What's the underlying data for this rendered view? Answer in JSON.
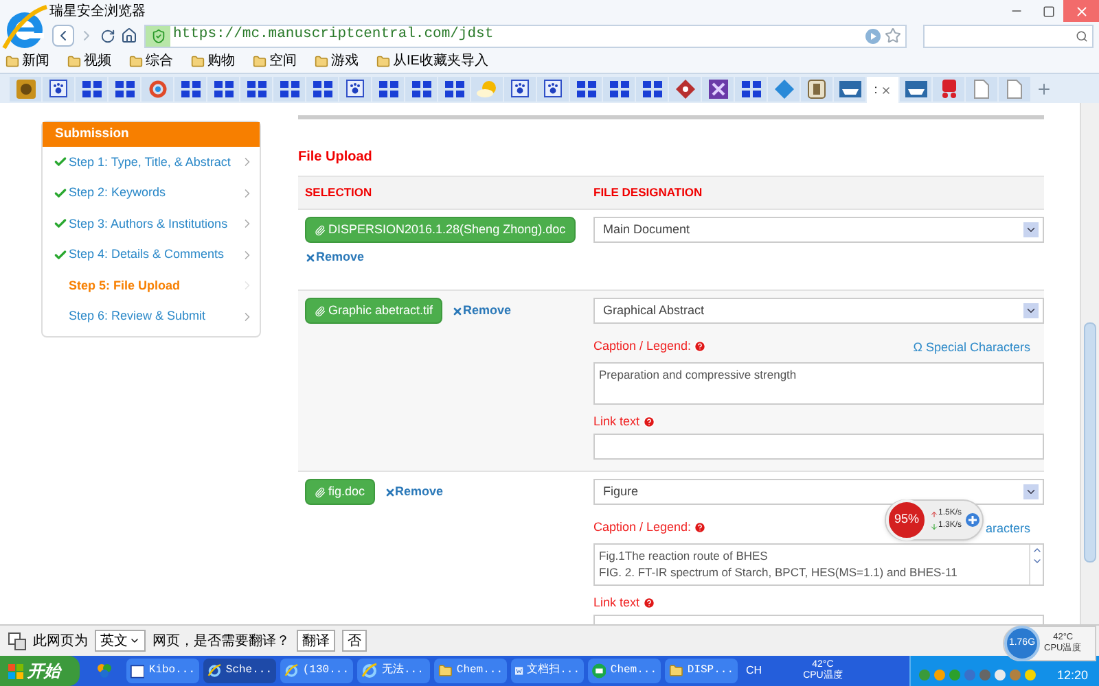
{
  "browser": {
    "title": "瑞星安全浏览器",
    "url": "https://mc.manuscriptcentral.com/jdst",
    "bookmarks": [
      "新闻",
      "视频",
      "综合",
      "购物",
      "空间",
      "游戏",
      "从IE收藏夹导入"
    ],
    "tabs": [
      {
        "kind": "tiger",
        "selected": false
      },
      {
        "kind": "paw",
        "selected": false
      },
      {
        "kind": "grid",
        "selected": false
      },
      {
        "kind": "grid",
        "selected": false
      },
      {
        "kind": "circle",
        "selected": false
      },
      {
        "kind": "grid",
        "selected": false
      },
      {
        "kind": "grid",
        "selected": false
      },
      {
        "kind": "grid",
        "selected": false
      },
      {
        "kind": "grid",
        "selected": false
      },
      {
        "kind": "grid",
        "selected": false
      },
      {
        "kind": "paw",
        "selected": false
      },
      {
        "kind": "grid",
        "selected": false
      },
      {
        "kind": "grid",
        "selected": false
      },
      {
        "kind": "grid",
        "selected": false
      },
      {
        "kind": "sun",
        "selected": false
      },
      {
        "kind": "paw",
        "selected": false
      },
      {
        "kind": "paw",
        "selected": false
      },
      {
        "kind": "grid",
        "selected": false
      },
      {
        "kind": "grid",
        "selected": false
      },
      {
        "kind": "grid",
        "selected": false
      },
      {
        "kind": "diamond",
        "selected": false
      },
      {
        "kind": "cross",
        "selected": false
      },
      {
        "kind": "grid",
        "selected": false
      },
      {
        "kind": "bluediamond",
        "selected": false
      },
      {
        "kind": "square",
        "selected": false
      },
      {
        "kind": "boat",
        "selected": false
      },
      {
        "kind": "blank",
        "selected": true,
        "label": ":"
      },
      {
        "kind": "boat",
        "selected": false
      },
      {
        "kind": "red",
        "selected": false
      },
      {
        "kind": "page",
        "selected": false
      },
      {
        "kind": "page",
        "selected": false
      }
    ]
  },
  "sidebar": {
    "title": "Submission",
    "steps": [
      {
        "label": "Step 1: Type, Title, & Abstract",
        "done": true,
        "selected": false
      },
      {
        "label": "Step 2: Keywords",
        "done": true,
        "selected": false
      },
      {
        "label": "Step 3: Authors & Institutions",
        "done": true,
        "selected": false
      },
      {
        "label": "Step 4: Details & Comments",
        "done": true,
        "selected": false
      },
      {
        "label": "Step 5: File Upload",
        "done": false,
        "selected": true
      },
      {
        "label": "Step 6: Review & Submit",
        "done": false,
        "selected": false
      }
    ]
  },
  "main": {
    "heading": "File Upload",
    "columns": [
      "SELECTION",
      "FILE DESIGNATION"
    ],
    "files": [
      {
        "name": "DISPERSION2016.1.28(Sheng Zhong).doc",
        "remove": "Remove",
        "designation": "Main Document"
      },
      {
        "name": "Graphic abetract.tif",
        "remove": "Remove",
        "designation": "Graphical Abstract",
        "caption_label": "Caption / Legend:",
        "special": "Ω Special Characters",
        "caption_lines": [
          "Preparation and  compressive strength"
        ],
        "scrollable": false,
        "link_label": "Link text"
      },
      {
        "name": "fig.doc",
        "remove": "Remove",
        "designation": "Figure",
        "caption_label": "Caption / Legend:",
        "special": "aracters",
        "caption_lines": [
          "Fig.1The reaction route of BHES",
          "FIG. 2. FT-IR spectrum of Starch, BPCT, HES(MS=1.1) and BHES-11"
        ],
        "scrollable": true,
        "link_label": "Link text"
      }
    ]
  },
  "net_widget": {
    "percent": "95%",
    "up": "1.5K/s",
    "down": "1.3K/s"
  },
  "cpu_widget": {
    "speed": "1.76G",
    "temp": "42°C",
    "label": "CPU温度"
  },
  "translate_bar": {
    "prefix": "此网页为",
    "language": "英文",
    "question": "网页，是否需要翻译？",
    "buttons": [
      "翻译",
      "否"
    ]
  },
  "taskbar": {
    "start": "开始",
    "items": [
      {
        "label": "Kibo...",
        "kind": "window",
        "selected": false
      },
      {
        "label": "Sche...",
        "kind": "ie",
        "selected": true
      },
      {
        "label": "(130...",
        "kind": "ie",
        "selected": false
      },
      {
        "label": "无法...",
        "kind": "ie",
        "selected": false
      },
      {
        "label": "Chem...",
        "kind": "folder",
        "selected": false
      },
      {
        "label": "文档扫...",
        "kind": "doc",
        "selected": false
      },
      {
        "label": "Chem...",
        "kind": "app",
        "selected": false
      },
      {
        "label": "DISP...",
        "kind": "folder",
        "selected": false
      }
    ],
    "lang": "CH",
    "temp": "42°C",
    "temp_label": "CPU温度",
    "time": "12:20"
  }
}
